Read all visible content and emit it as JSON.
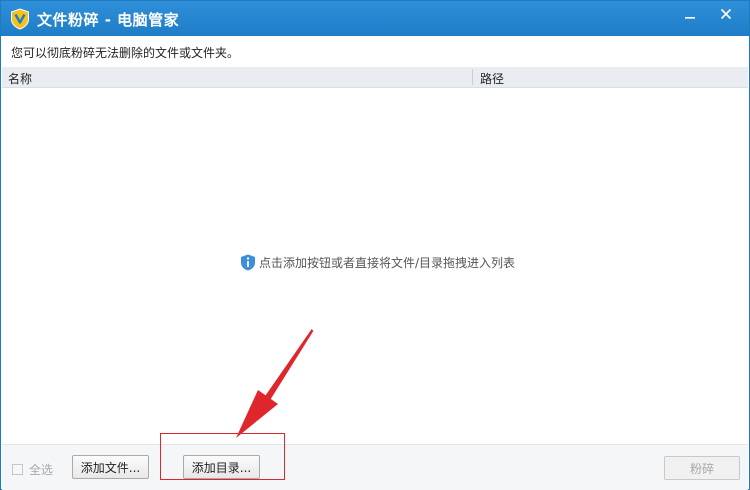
{
  "window": {
    "title": "文件粉碎 - 电脑管家",
    "icon": "tencent-pc-manager-shield-logo",
    "controls": [
      {
        "name": "minimize",
        "icon": "minimize-icon"
      },
      {
        "name": "close",
        "icon": "close-icon"
      }
    ]
  },
  "description": "您可以彻底粉碎无法删除的文件或文件夹。",
  "list": {
    "columns": [
      "名称",
      "路径"
    ],
    "rows": [],
    "empty_hint": "点击添加按钮或者直接将文件/目录拖拽进入列表",
    "empty_hint_icon": "info-icon"
  },
  "bottom": {
    "select_all_label": "全选",
    "select_all_checked": false,
    "select_all_enabled": false,
    "add_file_label": "添加文件...",
    "add_dir_label": "添加目录...",
    "shred_label": "粉碎",
    "shred_enabled": false
  },
  "annotation": {
    "highlight_target": "add-directory-button",
    "color": "#e0262d"
  },
  "colors": {
    "titlebar": "#2b8ad4",
    "accent": "#1f7bbf",
    "annotation": "#e0262d"
  }
}
